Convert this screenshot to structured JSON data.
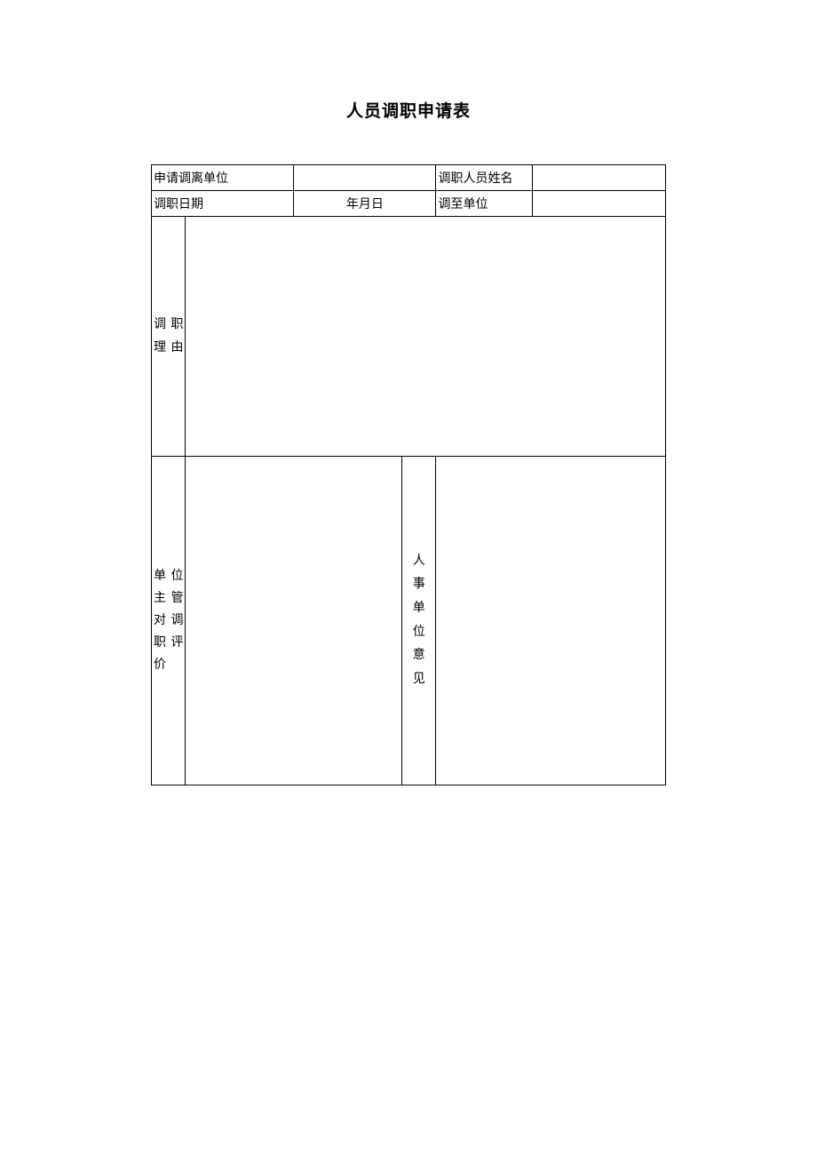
{
  "title": "人员调职申请表",
  "row1": {
    "label1": "申请调离单位",
    "value1": "",
    "label2": "调职人员姓名",
    "value2": ""
  },
  "row2": {
    "label1": "调职日期",
    "value1": "年月日",
    "label2": "调至单位",
    "value2": ""
  },
  "row3": {
    "label": "调职理由",
    "value": ""
  },
  "row4": {
    "label1": "单位主管对调职评价",
    "value1": "",
    "label2": "人事单位意见",
    "value2": ""
  }
}
